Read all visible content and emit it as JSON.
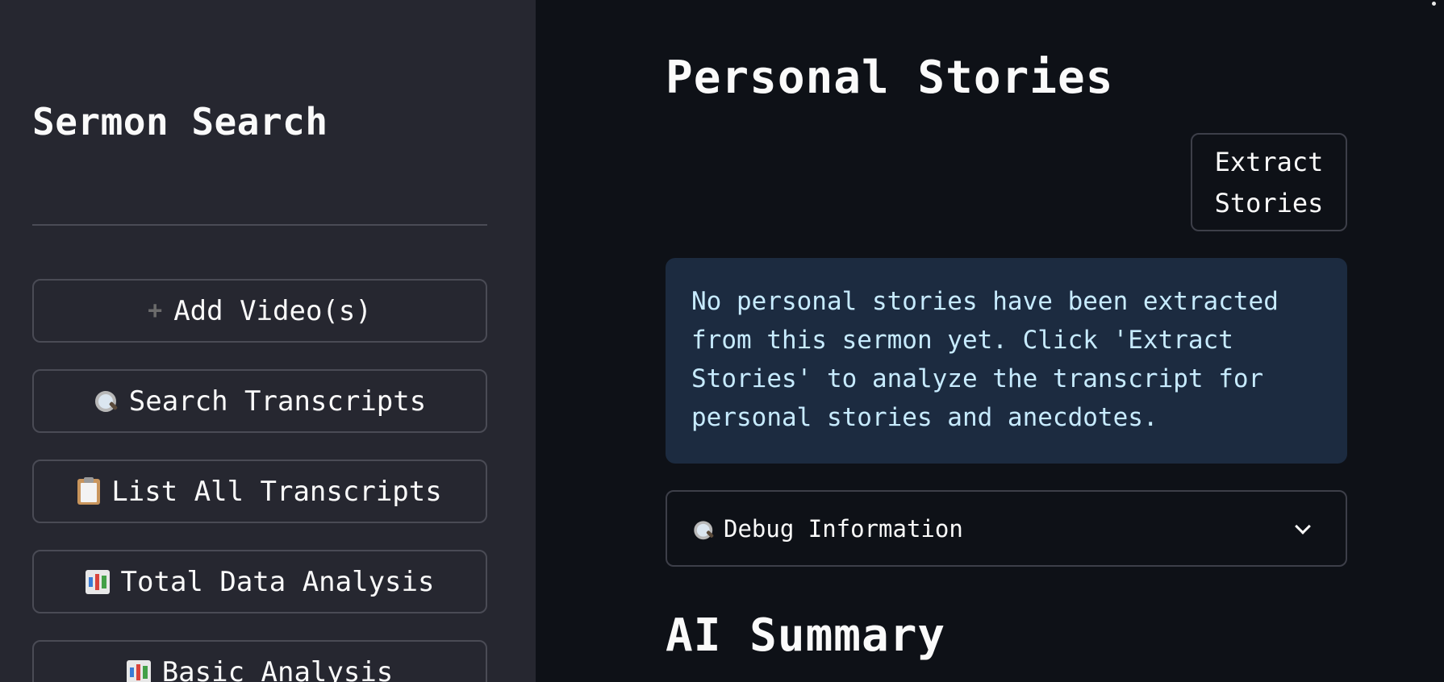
{
  "sidebar": {
    "title": "Sermon Search",
    "buttons": [
      {
        "label": "Add Video(s)",
        "icon": "plus-icon"
      },
      {
        "label": "Search Transcripts",
        "icon": "magnifier-icon"
      },
      {
        "label": "List All Transcripts",
        "icon": "clipboard-icon"
      },
      {
        "label": "Total Data Analysis",
        "icon": "bar-chart-icon"
      },
      {
        "label": "Basic Analysis",
        "icon": "bar-chart-icon"
      }
    ]
  },
  "main": {
    "title": "Personal Stories",
    "extract_button_line1": "Extract",
    "extract_button_line2": "Stories",
    "info_message": "No personal stories have been extracted from this sermon yet. Click 'Extract Stories' to analyze the transcript for personal stories and anecdotes.",
    "debug_expander": {
      "label": "Debug Information",
      "icon": "magnifier-icon"
    },
    "section_title": "AI Summary"
  },
  "colors": {
    "background": "#0e1117",
    "sidebar_background": "#262730",
    "info_background": "#1c2b40",
    "info_text": "#c7ebff"
  }
}
